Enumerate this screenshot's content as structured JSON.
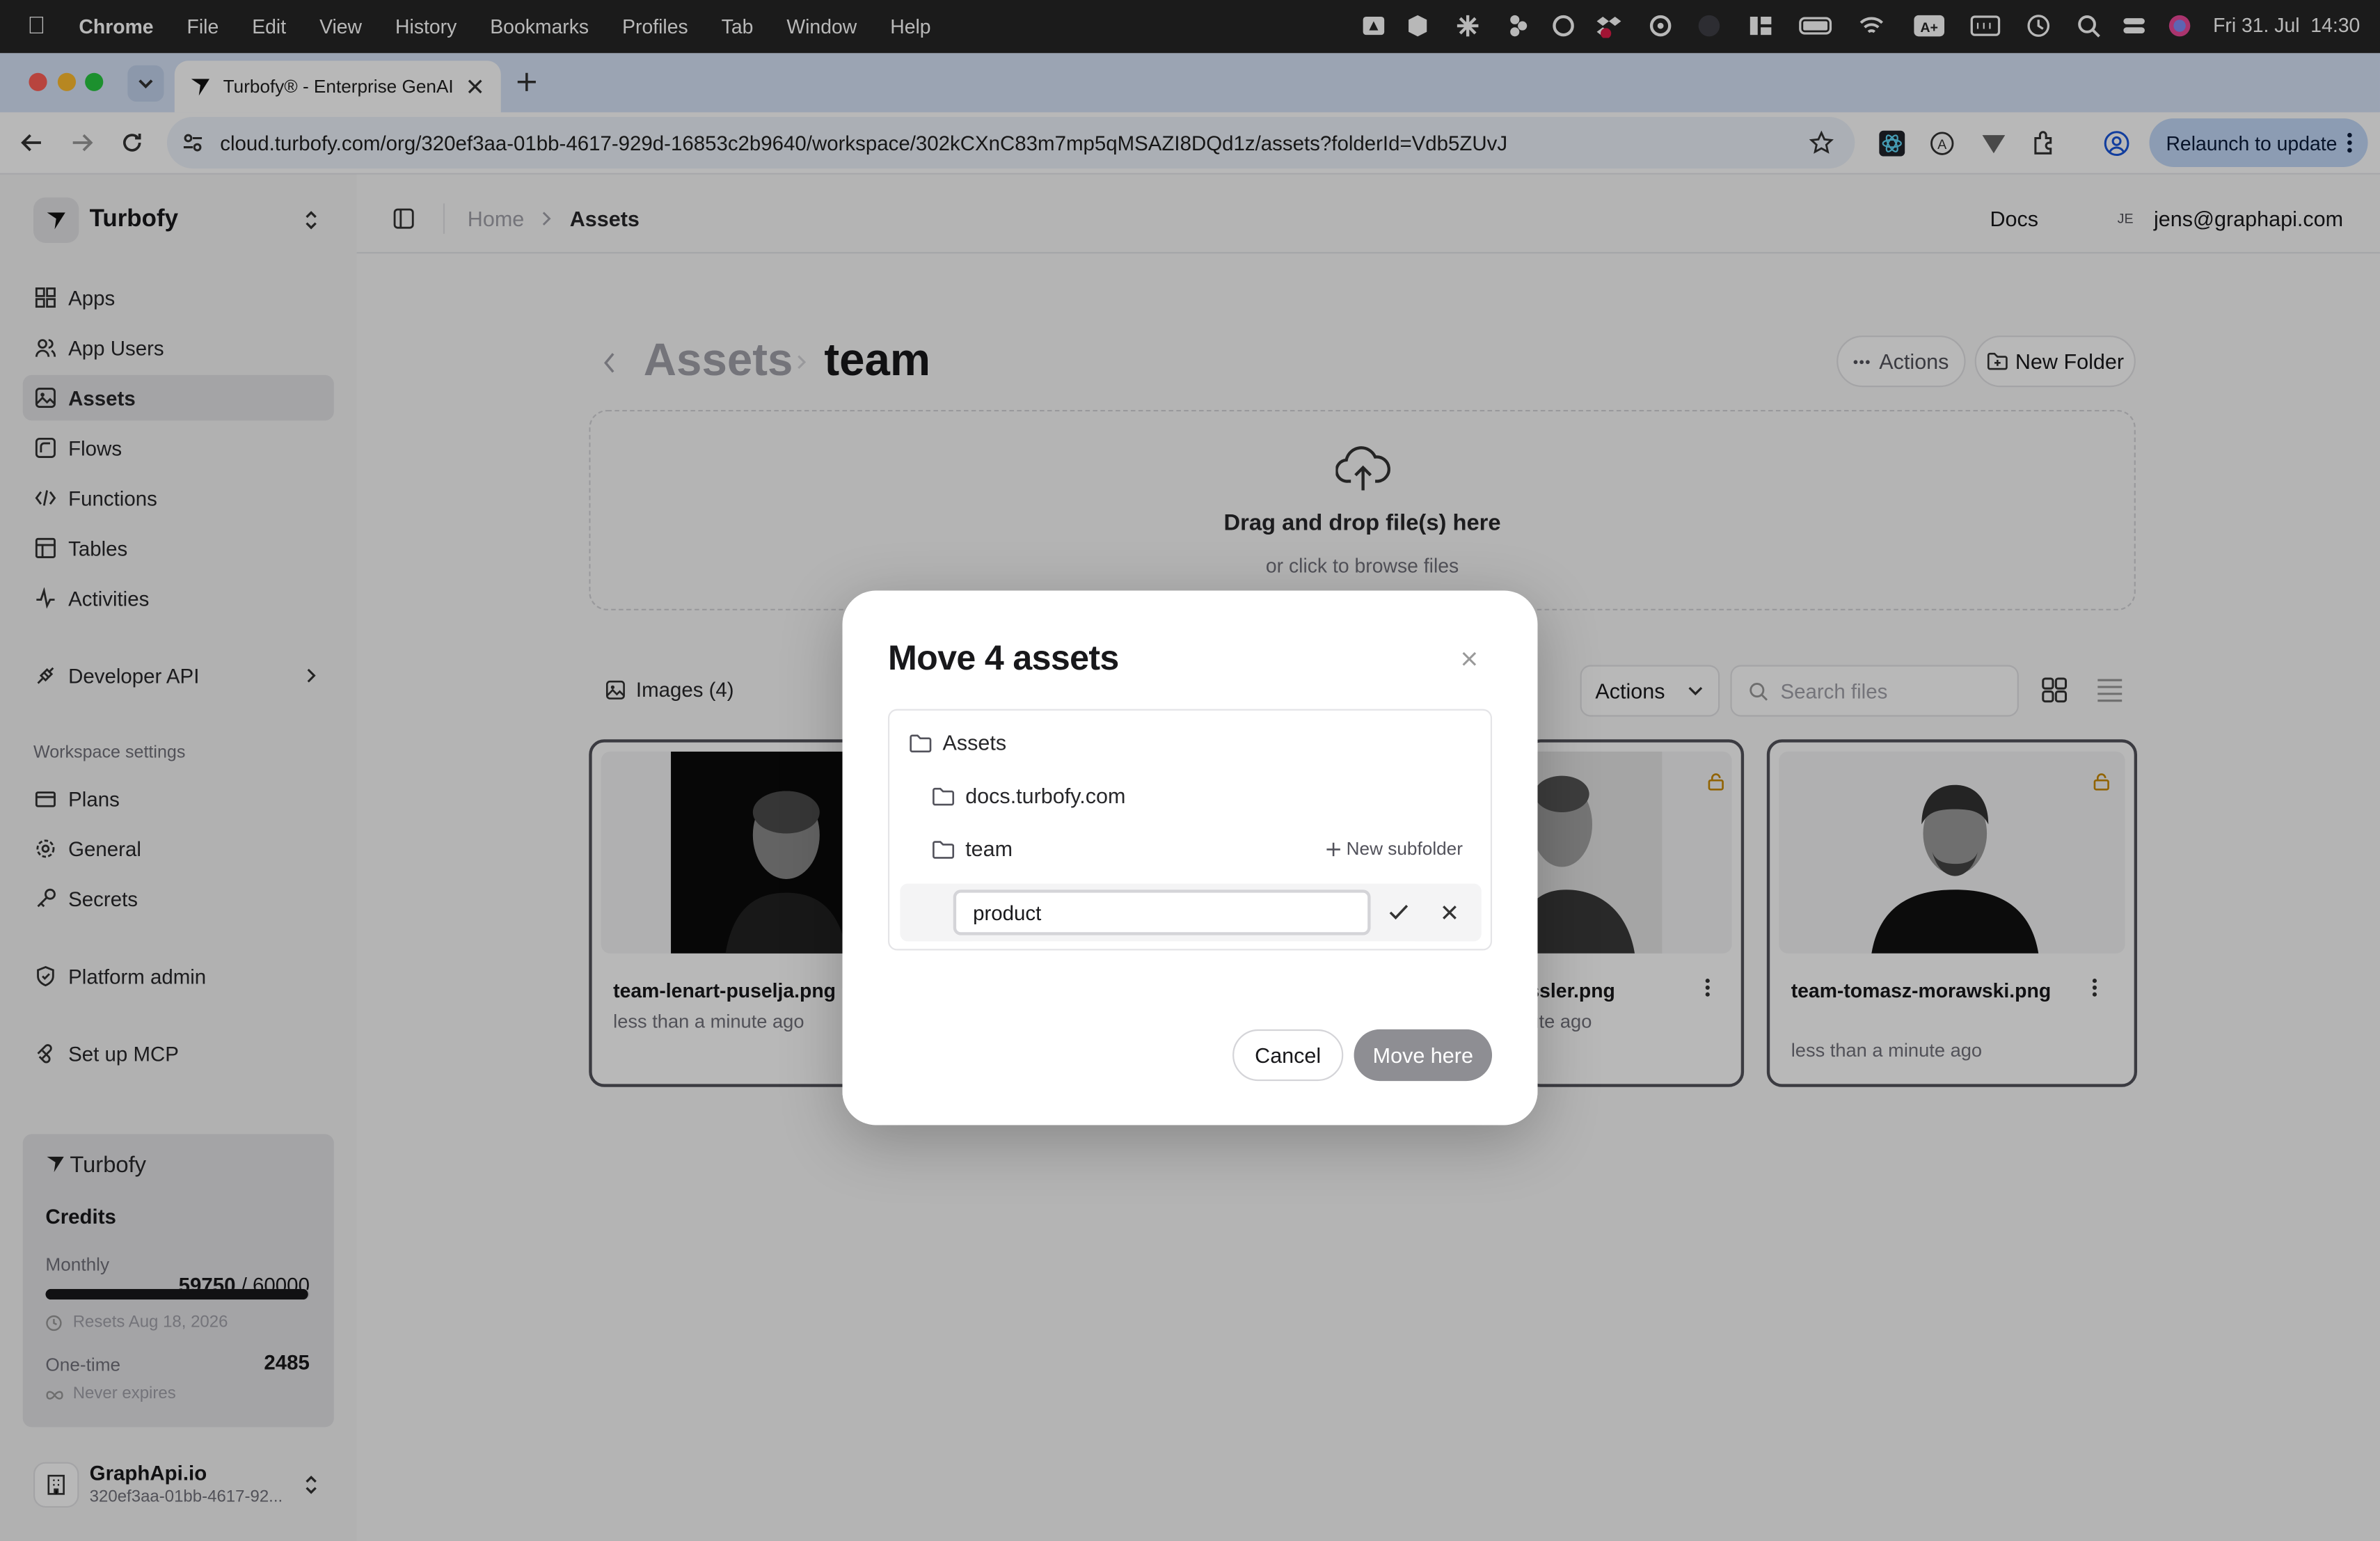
{
  "menubar": {
    "app_name": "Chrome",
    "items": [
      "File",
      "Edit",
      "View",
      "History",
      "Bookmarks",
      "Profiles",
      "Tab",
      "Window",
      "Help"
    ],
    "datetime": "Fri 31. Jul  14:30"
  },
  "browser": {
    "tab_title": "Turbofy® - Enterprise GenAI",
    "url": "cloud.turbofy.com/org/320ef3aa-01bb-4617-929d-16853c2b9640/workspace/302kCXnC83m7mp5qMSAZI8DQd1z/assets?folderId=Vdb5ZUvJ",
    "relaunch_label": "Relaunch to update"
  },
  "sidebar": {
    "brand": "Turbofy",
    "nav": [
      {
        "label": "Apps",
        "icon": "apps-icon"
      },
      {
        "label": "App Users",
        "icon": "users-icon"
      },
      {
        "label": "Assets",
        "icon": "image-icon",
        "active": true
      },
      {
        "label": "Flows",
        "icon": "flows-icon"
      },
      {
        "label": "Functions",
        "icon": "code-icon"
      },
      {
        "label": "Tables",
        "icon": "table-icon"
      },
      {
        "label": "Activities",
        "icon": "activity-icon"
      }
    ],
    "developer_api": "Developer API",
    "workspace_settings_heading": "Workspace settings",
    "settings": [
      {
        "label": "Plans",
        "icon": "plans-icon"
      },
      {
        "label": "General",
        "icon": "gear-icon"
      },
      {
        "label": "Secrets",
        "icon": "key-icon"
      }
    ],
    "platform_admin": "Platform admin",
    "setup_mcp": "Set up MCP",
    "credits": {
      "logo_text": "Turbofy",
      "title": "Credits",
      "monthly_label": "Monthly",
      "monthly_used": "59750",
      "monthly_total": " / 60000",
      "monthly_fraction": 0.996,
      "resets": "Resets Aug 18, 2026",
      "onetime_label": "One-time",
      "onetime_value": "2485",
      "never_expires": "Never expires"
    },
    "org": {
      "name": "GraphApi.io",
      "id": "320ef3aa-01bb-4617-92..."
    }
  },
  "topbar": {
    "breadcrumb_home": "Home",
    "breadcrumb_current": "Assets",
    "docs": "Docs",
    "avatar_initials": "JE",
    "user_email": "jens@graphapi.com"
  },
  "page": {
    "title_parent": "Assets",
    "title_current": "team",
    "actions_label": "Actions",
    "new_folder_label": "New Folder",
    "dropzone_title": "Drag and drop file(s) here",
    "dropzone_sub": "or click to browse files",
    "images_tab": "Images (4)",
    "actions_select": "Actions",
    "search_placeholder": "Search files",
    "files": [
      {
        "name": "team-lenart-puselja.png",
        "time": "less than a minute ago"
      },
      {
        "name": "ssler.png",
        "time": "ute ago"
      },
      {
        "name": "team-tomasz-morawski.png",
        "time": "less than a minute ago"
      }
    ]
  },
  "modal": {
    "title": "Move 4 assets",
    "tree": {
      "root": "Assets",
      "children": [
        "docs.turbofy.com",
        "team"
      ],
      "new_subfolder": "New subfolder",
      "new_folder_value": "product"
    },
    "cancel": "Cancel",
    "move_here": "Move here"
  }
}
